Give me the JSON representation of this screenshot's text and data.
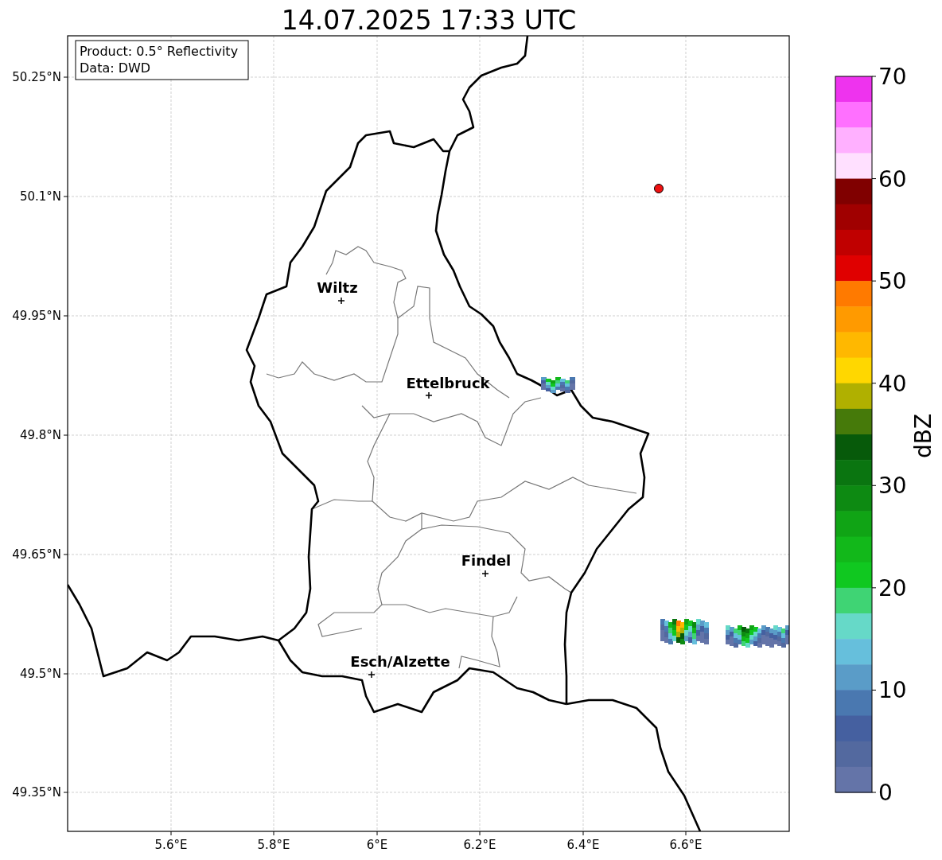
{
  "title": "14.07.2025 17:33 UTC",
  "legend": [
    "Product: 0.5° Reflectivity",
    "Data: DWD"
  ],
  "x_ticks": [
    "5.6°E",
    "5.8°E",
    "6°E",
    "6.2°E",
    "6.4°E",
    "6.6°E"
  ],
  "y_ticks": [
    "50.25°N",
    "50.1°N",
    "49.95°N",
    "49.8°N",
    "49.65°N",
    "49.5°N",
    "49.35°N"
  ],
  "cities": [
    {
      "name": "Wiltz"
    },
    {
      "name": "Ettelbruck"
    },
    {
      "name": "Findel"
    },
    {
      "name": "Esch/Alzette"
    }
  ],
  "colorbar": {
    "label": "dBZ",
    "ticks": [
      "70",
      "60",
      "50",
      "40",
      "30",
      "20",
      "10",
      "0"
    ],
    "segments": [
      {
        "color": "#ee33ee"
      },
      {
        "color": "#ff70ff"
      },
      {
        "color": "#ffb0ff"
      },
      {
        "color": "#ffe0ff"
      },
      {
        "color": "#800000"
      },
      {
        "color": "#a00000"
      },
      {
        "color": "#c00000"
      },
      {
        "color": "#e00000"
      },
      {
        "color": "#ff7a00"
      },
      {
        "color": "#ff9a00"
      },
      {
        "color": "#ffb800"
      },
      {
        "color": "#ffd700"
      },
      {
        "color": "#b0b000"
      },
      {
        "color": "#467a0a"
      },
      {
        "color": "#075a0a"
      },
      {
        "color": "#0a7510"
      },
      {
        "color": "#0d8a12"
      },
      {
        "color": "#10a415"
      },
      {
        "color": "#12b81a"
      },
      {
        "color": "#10c820"
      },
      {
        "color": "#3fd474"
      },
      {
        "color": "#66d9c8"
      },
      {
        "color": "#66bfdc"
      },
      {
        "color": "#5a9cc8"
      },
      {
        "color": "#4a78b0"
      },
      {
        "color": "#4560a0"
      },
      {
        "color": "#53699f"
      },
      {
        "color": "#6474a8"
      }
    ]
  }
}
